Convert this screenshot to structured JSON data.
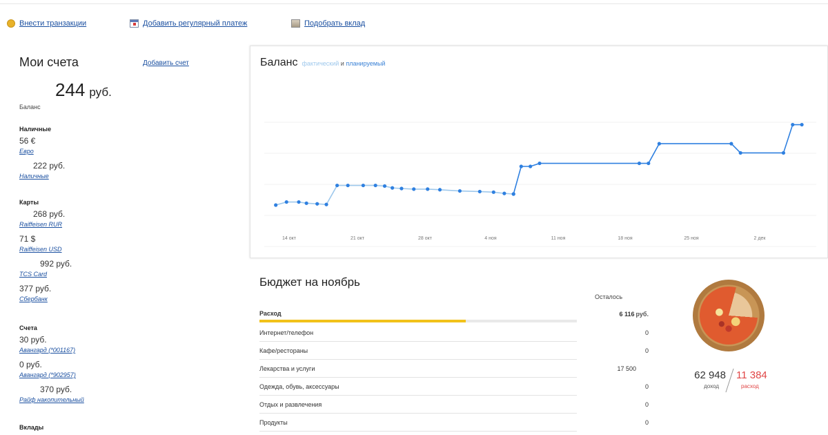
{
  "toolbar": {
    "enter_transactions": "Внести транзакции",
    "add_regular_payment": "Добавить регулярный платеж",
    "pick_deposit": "Подобрать вклад"
  },
  "sidebar": {
    "title": "Мои счета",
    "add_account": "Добавить счет",
    "total_value": "244",
    "total_currency": "руб.",
    "total_label": "Баланс",
    "groups": [
      {
        "header": "Наличные",
        "accounts": [
          {
            "value": "56 €",
            "name": "Евро"
          },
          {
            "value": "222 руб.",
            "name": "Наличные"
          }
        ]
      },
      {
        "header": "Карты",
        "accounts": [
          {
            "value": "268 руб.",
            "name": "Raiffeisen RUR"
          },
          {
            "value": "71 $",
            "name": "Raiffeisen USD"
          },
          {
            "value": "992 руб.",
            "name": "TCS Card"
          },
          {
            "value": "377 руб.",
            "name": "Сбербанк"
          }
        ]
      },
      {
        "header": "Счета",
        "accounts": [
          {
            "value": "30 руб.",
            "name": "Авангард (*001167)"
          },
          {
            "value": "0 руб.",
            "name": "Авангард (*902957)"
          },
          {
            "value": "370 руб.",
            "name": "Райф накопительный"
          }
        ]
      },
      {
        "header": "Вклады",
        "accounts": []
      }
    ]
  },
  "balance": {
    "title": "Баланс",
    "fact_label": "фактический",
    "and_label": "и",
    "plan_label": "планируемый",
    "colors": {
      "fact": "#9ec8ec",
      "plan": "#2f80e0"
    }
  },
  "chart_data": {
    "type": "line",
    "title": "Баланс",
    "x_ticks": [
      "14 окт",
      "21 окт",
      "28 окт",
      "4 ноя",
      "11 ноя",
      "18 ноя",
      "25 ноя",
      "2 дек"
    ],
    "series": [
      {
        "name": "фактический",
        "points": [
          [
            0.3,
            275
          ],
          [
            1.0,
            270
          ],
          [
            1.8,
            270
          ],
          [
            2.3,
            272
          ],
          [
            3.0,
            273
          ],
          [
            3.6,
            274
          ],
          [
            4.3,
            243
          ],
          [
            5.0,
            243
          ],
          [
            6.0,
            243
          ],
          [
            6.8,
            243
          ],
          [
            7.4,
            244
          ],
          [
            7.9,
            247
          ],
          [
            8.5,
            248
          ],
          [
            9.3,
            249
          ],
          [
            10.2,
            249
          ],
          [
            11.0,
            250
          ],
          [
            12.3,
            252
          ],
          [
            13.6,
            253
          ],
          [
            14.5,
            254
          ],
          [
            15.2,
            256
          ],
          [
            15.8,
            257
          ]
        ]
      },
      {
        "name": "планируемый",
        "points": [
          [
            15.8,
            257
          ],
          [
            16.3,
            212
          ],
          [
            16.9,
            212
          ],
          [
            17.5,
            207
          ],
          [
            24.0,
            207
          ],
          [
            24.6,
            207
          ],
          [
            25.3,
            175
          ],
          [
            30.0,
            175
          ],
          [
            30.6,
            190
          ],
          [
            33.4,
            190
          ],
          [
            34.0,
            144
          ],
          [
            34.6,
            144
          ]
        ]
      }
    ],
    "note_y": "relative pixel-free level units: higher number = lower balance",
    "grid": true
  },
  "budget": {
    "title": "Бюджет на ноябрь",
    "left_header": "Осталось",
    "spend_label": "Расход",
    "spend_value": "6 116",
    "spend_currency": "руб.",
    "spend_progress": 0.65,
    "rows": [
      {
        "label": "Интернет/телефон",
        "value": "0"
      },
      {
        "label": "Кафе/рестораны",
        "value": "0"
      },
      {
        "label": "Лекарства и услуги",
        "value": "17 500"
      },
      {
        "label": "Одежда, обувь, аксессуары",
        "value": "0"
      },
      {
        "label": "Отдых и развлечения",
        "value": "0"
      },
      {
        "label": "Продукты",
        "value": "0"
      }
    ],
    "income_value": "62 948",
    "income_label": "доход",
    "expense_value": "11 384",
    "expense_label": "расход",
    "colors": {
      "spend_bar": "#f2c21a",
      "expense": "#e04646"
    }
  }
}
